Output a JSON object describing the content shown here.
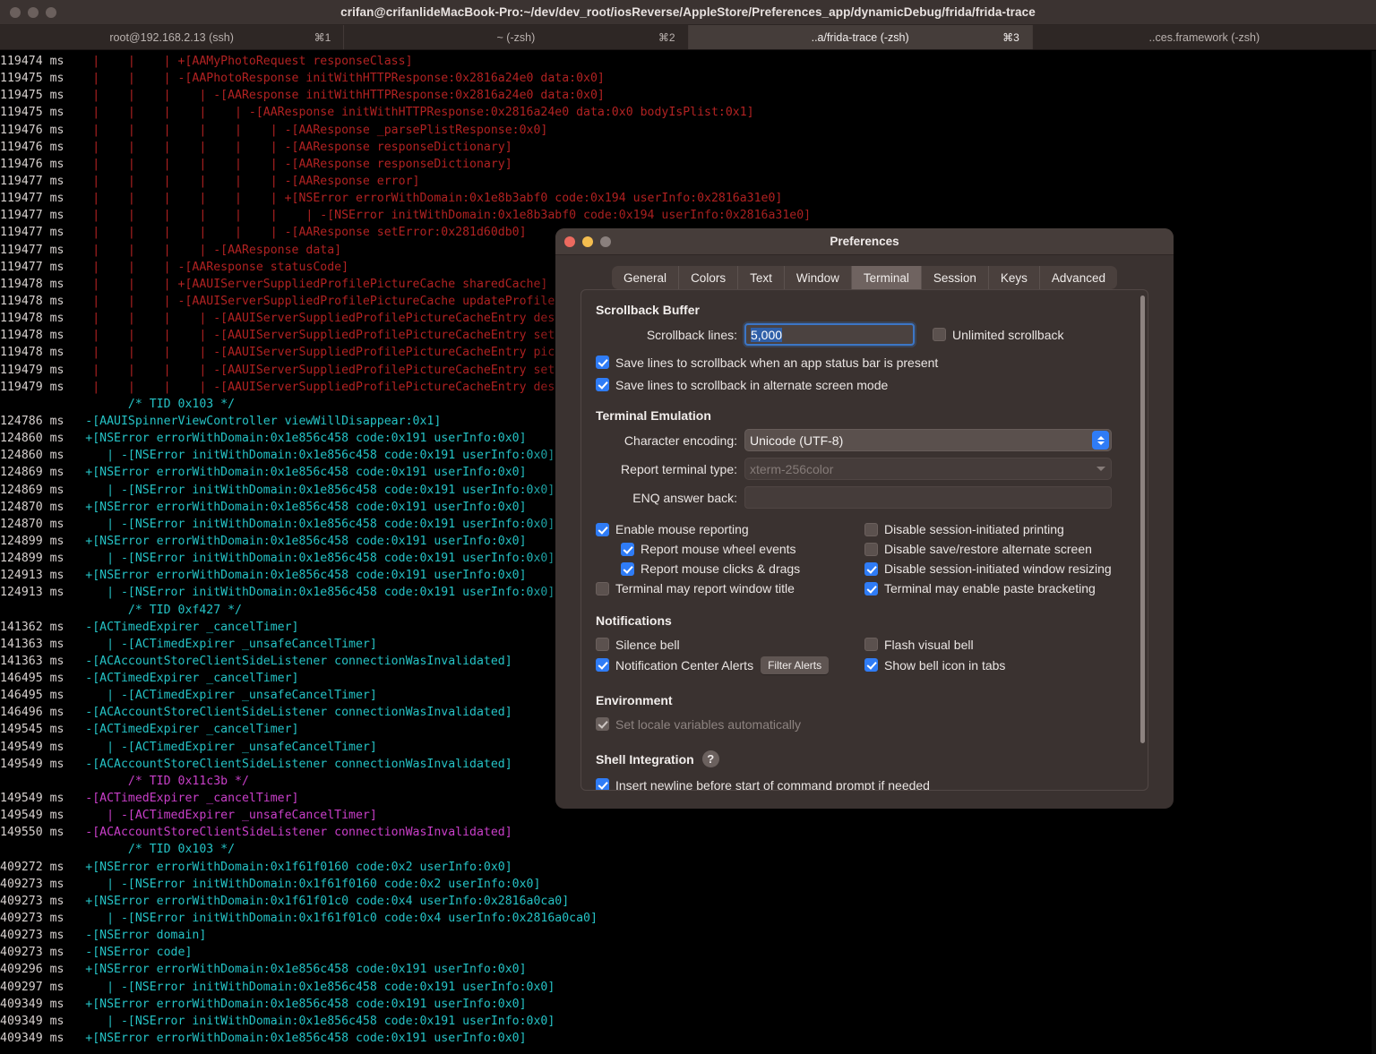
{
  "window": {
    "title": "crifan@crifanlideMacBook-Pro:~/dev/dev_root/iosReverse/AppleStore/Preferences_app/dynamicDebug/frida/frida-trace",
    "tabs": [
      {
        "label": "root@192.168.2.13 (ssh)",
        "shortcut": "⌘1",
        "active": false
      },
      {
        "label": "~ (-zsh)",
        "shortcut": "⌘2",
        "active": false
      },
      {
        "label": "..a/frida-trace (-zsh)",
        "shortcut": "⌘3",
        "active": true
      },
      {
        "label": "..ces.framework (-zsh)",
        "shortcut": "",
        "active": false
      }
    ]
  },
  "terminal": {
    "lines": [
      {
        "ts": "119474 ms",
        "color": "red",
        "text": "   |    |    | +[AAMyPhotoRequest responseClass]"
      },
      {
        "ts": "119475 ms",
        "color": "red",
        "text": "   |    |    | -[AAPhotoResponse initWithHTTPResponse:0x2816a24e0 data:0x0]"
      },
      {
        "ts": "119475 ms",
        "color": "red",
        "text": "   |    |    |    | -[AAResponse initWithHTTPResponse:0x2816a24e0 data:0x0]"
      },
      {
        "ts": "119475 ms",
        "color": "red",
        "text": "   |    |    |    |    | -[AAResponse initWithHTTPResponse:0x2816a24e0 data:0x0 bodyIsPlist:0x1]"
      },
      {
        "ts": "119476 ms",
        "color": "red",
        "text": "   |    |    |    |    |    | -[AAResponse _parsePlistResponse:0x0]"
      },
      {
        "ts": "119476 ms",
        "color": "red",
        "text": "   |    |    |    |    |    | -[AAResponse responseDictionary]"
      },
      {
        "ts": "119476 ms",
        "color": "red",
        "text": "   |    |    |    |    |    | -[AAResponse responseDictionary]"
      },
      {
        "ts": "119477 ms",
        "color": "red",
        "text": "   |    |    |    |    |    | -[AAResponse error]"
      },
      {
        "ts": "119477 ms",
        "color": "red",
        "text": "   |    |    |    |    |    | +[NSError errorWithDomain:0x1e8b3abf0 code:0x194 userInfo:0x2816a31e0]"
      },
      {
        "ts": "119477 ms",
        "color": "red",
        "text": "   |    |    |    |    |    |    | -[NSError initWithDomain:0x1e8b3abf0 code:0x194 userInfo:0x2816a31e0]"
      },
      {
        "ts": "119477 ms",
        "color": "red",
        "text": "   |    |    |    |    |    | -[AAResponse setError:0x281d60db0]"
      },
      {
        "ts": "119477 ms",
        "color": "red",
        "text": "   |    |    |    | -[AAResponse data]"
      },
      {
        "ts": "119477 ms",
        "color": "red",
        "text": "   |    |    | -[AAResponse statusCode]"
      },
      {
        "ts": "119478 ms",
        "color": "red",
        "text": "   |    |    | +[AAUIServerSuppliedProfilePictureCache sharedCache]"
      },
      {
        "ts": "119478 ms",
        "color": "red",
        "text": "   |    |    | -[AAUIServerSuppliedProfilePictureCache updateProfilePictureCacheEntry]"
      },
      {
        "ts": "119478 ms",
        "color": "red",
        "text": "   |    |    |    | -[AAUIServerSuppliedProfilePictureCacheEntry description]"
      },
      {
        "ts": "119478 ms",
        "color": "red",
        "text": "   |    |    |    | -[AAUIServerSuppliedProfilePictureCacheEntry setPictureData:]"
      },
      {
        "ts": "119478 ms",
        "color": "red",
        "text": "   |    |    |    | -[AAUIServerSuppliedProfilePictureCacheEntry pictureData]"
      },
      {
        "ts": "119479 ms",
        "color": "red",
        "text": "   |    |    |    | -[AAUIServerSuppliedProfilePictureCacheEntry setDate:]"
      },
      {
        "ts": "119479 ms",
        "color": "red",
        "text": "   |    |    |    | -[AAUIServerSuppliedProfilePictureCacheEntry description]"
      },
      {
        "ts": "",
        "color": "cyan",
        "text": "        /* TID 0x103 */"
      },
      {
        "ts": "124786 ms",
        "color": "cyan",
        "text": "  -[AAUISpinnerViewController viewWillDisappear:0x1]"
      },
      {
        "ts": "124860 ms",
        "color": "cyan",
        "text": "  +[NSError errorWithDomain:0x1e856c458 code:0x191 userInfo:0x0]"
      },
      {
        "ts": "124860 ms",
        "color": "cyan",
        "text": "     | -[NSError initWithDomain:0x1e856c458 code:0x191 userInfo:0x0]"
      },
      {
        "ts": "124869 ms",
        "color": "cyan",
        "text": "  +[NSError errorWithDomain:0x1e856c458 code:0x191 userInfo:0x0]"
      },
      {
        "ts": "124869 ms",
        "color": "cyan",
        "text": "     | -[NSError initWithDomain:0x1e856c458 code:0x191 userInfo:0x0]"
      },
      {
        "ts": "124870 ms",
        "color": "cyan",
        "text": "  +[NSError errorWithDomain:0x1e856c458 code:0x191 userInfo:0x0]"
      },
      {
        "ts": "124870 ms",
        "color": "cyan",
        "text": "     | -[NSError initWithDomain:0x1e856c458 code:0x191 userInfo:0x0]"
      },
      {
        "ts": "124899 ms",
        "color": "cyan",
        "text": "  +[NSError errorWithDomain:0x1e856c458 code:0x191 userInfo:0x0]"
      },
      {
        "ts": "124899 ms",
        "color": "cyan",
        "text": "     | -[NSError initWithDomain:0x1e856c458 code:0x191 userInfo:0x0]"
      },
      {
        "ts": "124913 ms",
        "color": "cyan",
        "text": "  +[NSError errorWithDomain:0x1e856c458 code:0x191 userInfo:0x0]"
      },
      {
        "ts": "124913 ms",
        "color": "cyan",
        "text": "     | -[NSError initWithDomain:0x1e856c458 code:0x191 userInfo:0x0]"
      },
      {
        "ts": "",
        "color": "cyan",
        "text": "        /* TID 0xf427 */"
      },
      {
        "ts": "141362 ms",
        "color": "cyan",
        "text": "  -[ACTimedExpirer _cancelTimer]"
      },
      {
        "ts": "141363 ms",
        "color": "cyan",
        "text": "     | -[ACTimedExpirer _unsafeCancelTimer]"
      },
      {
        "ts": "141363 ms",
        "color": "cyan",
        "text": "  -[ACAccountStoreClientSideListener connectionWasInvalidated]"
      },
      {
        "ts": "146495 ms",
        "color": "cyan",
        "text": "  -[ACTimedExpirer _cancelTimer]"
      },
      {
        "ts": "146495 ms",
        "color": "cyan",
        "text": "     | -[ACTimedExpirer _unsafeCancelTimer]"
      },
      {
        "ts": "146496 ms",
        "color": "cyan",
        "text": "  -[ACAccountStoreClientSideListener connectionWasInvalidated]"
      },
      {
        "ts": "149545 ms",
        "color": "cyan",
        "text": "  -[ACTimedExpirer _cancelTimer]"
      },
      {
        "ts": "149549 ms",
        "color": "cyan",
        "text": "     | -[ACTimedExpirer _unsafeCancelTimer]"
      },
      {
        "ts": "149549 ms",
        "color": "cyan",
        "text": "  -[ACAccountStoreClientSideListener connectionWasInvalidated]"
      },
      {
        "ts": "",
        "color": "mag",
        "text": "        /* TID 0x11c3b */"
      },
      {
        "ts": "149549 ms",
        "color": "mag",
        "text": "  -[ACTimedExpirer _cancelTimer]"
      },
      {
        "ts": "149549 ms",
        "color": "mag",
        "text": "     | -[ACTimedExpirer _unsafeCancelTimer]"
      },
      {
        "ts": "149550 ms",
        "color": "mag",
        "text": "  -[ACAccountStoreClientSideListener connectionWasInvalidated]"
      },
      {
        "ts": "",
        "color": "cyan",
        "text": "        /* TID 0x103 */"
      },
      {
        "ts": "409272 ms",
        "color": "cyan",
        "text": "  +[NSError errorWithDomain:0x1f61f0160 code:0x2 userInfo:0x0]"
      },
      {
        "ts": "409273 ms",
        "color": "cyan",
        "text": "     | -[NSError initWithDomain:0x1f61f0160 code:0x2 userInfo:0x0]"
      },
      {
        "ts": "409273 ms",
        "color": "cyan",
        "text": "  +[NSError errorWithDomain:0x1f61f01c0 code:0x4 userInfo:0x2816a0ca0]"
      },
      {
        "ts": "409273 ms",
        "color": "cyan",
        "text": "     | -[NSError initWithDomain:0x1f61f01c0 code:0x4 userInfo:0x2816a0ca0]"
      },
      {
        "ts": "409273 ms",
        "color": "cyan",
        "text": "  -[NSError domain]"
      },
      {
        "ts": "409273 ms",
        "color": "cyan",
        "text": "  -[NSError code]"
      },
      {
        "ts": "409296 ms",
        "color": "cyan",
        "text": "  +[NSError errorWithDomain:0x1e856c458 code:0x191 userInfo:0x0]"
      },
      {
        "ts": "409297 ms",
        "color": "cyan",
        "text": "     | -[NSError initWithDomain:0x1e856c458 code:0x191 userInfo:0x0]"
      },
      {
        "ts": "409349 ms",
        "color": "cyan",
        "text": "  +[NSError errorWithDomain:0x1e856c458 code:0x191 userInfo:0x0]"
      },
      {
        "ts": "409349 ms",
        "color": "cyan",
        "text": "     | -[NSError initWithDomain:0x1e856c458 code:0x191 userInfo:0x0]"
      },
      {
        "ts": "409349 ms",
        "color": "cyan",
        "text": "  +[NSError errorWithDomain:0x1e856c458 code:0x191 userInfo:0x0]"
      }
    ]
  },
  "prefs": {
    "title": "Preferences",
    "tabs": [
      {
        "label": "General",
        "active": false
      },
      {
        "label": "Colors",
        "active": false
      },
      {
        "label": "Text",
        "active": false
      },
      {
        "label": "Window",
        "active": false
      },
      {
        "label": "Terminal",
        "active": true
      },
      {
        "label": "Session",
        "active": false
      },
      {
        "label": "Keys",
        "active": false
      },
      {
        "label": "Advanced",
        "active": false
      }
    ],
    "scrollback": {
      "group_title": "Scrollback Buffer",
      "lines_label": "Scrollback lines:",
      "lines_value": "5,000",
      "unlimited_label": "Unlimited scrollback",
      "unlimited_checked": false,
      "save_status_bar_label": "Save lines to scrollback when an app status bar is present",
      "save_status_bar_checked": true,
      "save_alt_screen_label": "Save lines to scrollback in alternate screen mode",
      "save_alt_screen_checked": true
    },
    "emulation": {
      "group_title": "Terminal Emulation",
      "encoding_label": "Character encoding:",
      "encoding_value": "Unicode (UTF-8)",
      "termtype_label": "Report terminal type:",
      "termtype_value": "xterm-256color",
      "enq_label": "ENQ answer back:",
      "enq_value": "",
      "checks_left": [
        {
          "label": "Enable mouse reporting",
          "checked": true,
          "indent": 0
        },
        {
          "label": "Report mouse wheel events",
          "checked": true,
          "indent": 1
        },
        {
          "label": "Report mouse clicks & drags",
          "checked": true,
          "indent": 1
        },
        {
          "label": "Terminal may report window title",
          "checked": false,
          "indent": 0
        }
      ],
      "checks_right": [
        {
          "label": "Disable session-initiated printing",
          "checked": false
        },
        {
          "label": "Disable save/restore alternate screen",
          "checked": false
        },
        {
          "label": "Disable session-initiated window resizing",
          "checked": true
        },
        {
          "label": "Terminal may enable paste bracketing",
          "checked": true
        }
      ]
    },
    "notifications": {
      "group_title": "Notifications",
      "silence_bell_label": "Silence bell",
      "silence_bell_checked": false,
      "flash_visual_bell_label": "Flash visual bell",
      "flash_visual_bell_checked": false,
      "nc_alerts_label": "Notification Center Alerts",
      "nc_alerts_checked": true,
      "filter_alerts_button": "Filter Alerts",
      "show_bell_tabs_label": "Show bell icon in tabs",
      "show_bell_tabs_checked": true
    },
    "environment": {
      "group_title": "Environment",
      "locale_label": "Set locale variables automatically",
      "locale_checked": true,
      "locale_disabled": true
    },
    "shell": {
      "group_title": "Shell Integration",
      "help_glyph": "?",
      "newline_label": "Insert newline before start of command prompt if needed",
      "newline_checked": true
    }
  }
}
